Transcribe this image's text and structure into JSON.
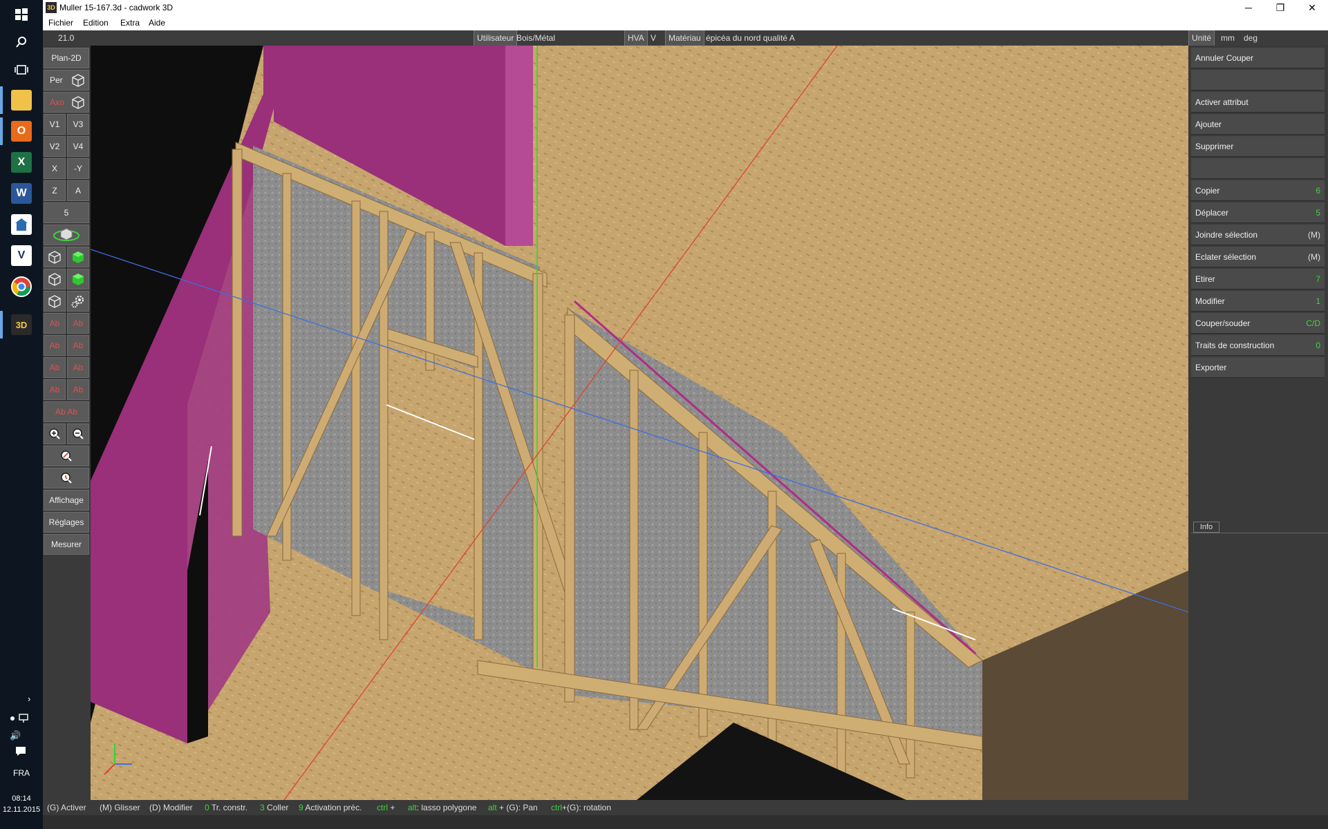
{
  "window": {
    "title": "Muller 15-167.3d - cadwork 3D",
    "app_icon": "3D",
    "controls": {
      "minimize": "─",
      "maximize": "❐",
      "close": "✕"
    }
  },
  "menu": [
    "Fichier",
    "Edition",
    "Extra",
    "Aide"
  ],
  "infobar": {
    "scale": "21.0",
    "user_label": "Utilisateur",
    "user_value": "Bois/Métal",
    "hva_label": "HVA",
    "hva_value": "V",
    "material_label": "Matériau",
    "material_value": "épicéa du nord qualité A",
    "unit_label": "Unité",
    "unit_length": "mm",
    "unit_angle": "deg"
  },
  "left_toolbar": {
    "plan2d": "Plan-2D",
    "per": "Per",
    "axo": "Axo",
    "v1": "V1",
    "v3": "V3",
    "v2": "V2",
    "v4": "V4",
    "x": "X",
    "neg_y": "-Y",
    "z": "Z",
    "a": "A",
    "five": "5",
    "red_rows": [
      [
        "Ab",
        "Ab"
      ],
      [
        "Ab",
        "Ab"
      ],
      [
        "Ab",
        "Ab"
      ],
      [
        "Ab",
        "Ab"
      ]
    ],
    "red_wide": "Ab Ab",
    "affichage": "Affichage",
    "reglages": "Réglages",
    "mesurer": "Mesurer"
  },
  "right_panel": {
    "annuler_couper": "Annuler Couper",
    "activer_attribut": "Activer attribut",
    "ajouter": "Ajouter",
    "supprimer": "Supprimer",
    "items": [
      {
        "label": "Copier",
        "shortcut": "6"
      },
      {
        "label": "Déplacer",
        "shortcut": "5"
      },
      {
        "label": "Joindre sélection",
        "shortcut": "(M)"
      },
      {
        "label": "Eclater sélection",
        "shortcut": "(M)"
      },
      {
        "label": "Etirer",
        "shortcut": "7"
      },
      {
        "label": "Modifier",
        "shortcut": "1"
      },
      {
        "label": "Couper/souder",
        "shortcut": "C/D"
      },
      {
        "label": "Traits de construction",
        "shortcut": "0"
      },
      {
        "label": "Exporter",
        "shortcut": ""
      }
    ],
    "info_tab": "Info"
  },
  "status": {
    "activer": "(G) Activer",
    "glisser": "(M) Glisser",
    "modifier": "(D) Modifier",
    "tr_key": "0",
    "tr_label": "Tr. constr.",
    "coller_key": "3",
    "coller_label": "Coller",
    "activation_key": "9",
    "activation_label": "Activation préc.",
    "ctrl1": "ctrl",
    "plus": "+",
    "alt1": "alt",
    "lasso": ": lasso polygone",
    "alt2": "alt",
    "pan": "+ (G): Pan",
    "ctrl2": "ctrl",
    "rotation": "+(G): rotation"
  },
  "taskbar": {
    "lang": "FRA",
    "time": "08:14",
    "date": "12.11.2015"
  },
  "colors": {
    "wood": "#c9a56b",
    "wood_dark": "#a98550",
    "panel": "#b8a07a",
    "insulation": "#8c8c8c",
    "magenta": "#9a2f7a",
    "accent_green": "#3fd43f",
    "axis_red": "#e0432a",
    "axis_green": "#2fd62f",
    "axis_blue": "#3d6fe0"
  }
}
